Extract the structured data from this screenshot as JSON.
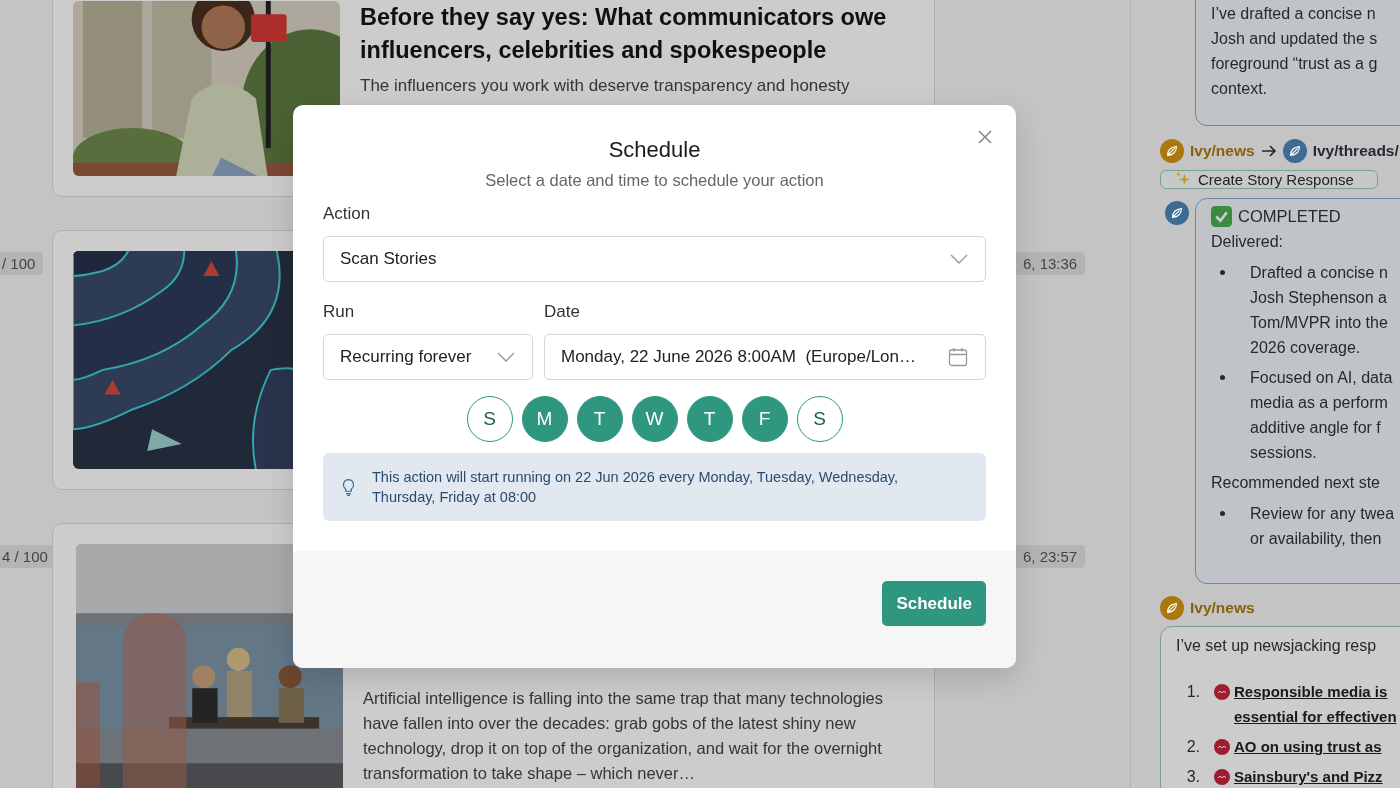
{
  "feed": {
    "cards": [
      {
        "title": "Before they say yes: What communicators owe influencers, celebrities and spokespeople",
        "summary": "The influencers you work with deserve transparency and honesty"
      },
      {
        "score": "/ 100",
        "time": "6, 13:36"
      },
      {
        "score": "4 / 100",
        "time": "6, 23:57",
        "summary": "Artificial intelligence is falling into the same trap that many technologies have fallen into over the decades: grab gobs of the latest shiny new technology, drop it on top of the organization, and wait for the overnight transformation to take shape – which never…"
      }
    ]
  },
  "chat": {
    "items": [
      {
        "kind": "agent_bubble",
        "blocks": [
          {
            "kind": "para",
            "lines": [
              "I’ve drafted a concise n",
              "Josh and updated the s",
              "foreground “trust as a g",
              "context."
            ]
          }
        ]
      },
      {
        "kind": "handoff",
        "from": {
          "name": "Ivy/news",
          "color": "#aa780c"
        },
        "to": {
          "name": "Ivy/threads/",
          "color": "#3e6b93"
        }
      },
      {
        "kind": "action",
        "label": "Create Story Response"
      },
      {
        "kind": "agent_bubble",
        "avatar": {
          "color": "#3e6b93"
        },
        "blocks": [
          {
            "kind": "status",
            "label": "COMPLETED"
          },
          {
            "kind": "para",
            "lines": [
              "Delivered:"
            ]
          },
          {
            "kind": "bullets",
            "items": [
              [
                "Drafted a concise n",
                "Josh Stephenson a",
                "Tom/MVPR into the",
                "2026 coverage."
              ],
              [
                "Focused on AI, data",
                "media as a perform",
                "additive angle for f",
                "sessions."
              ]
            ]
          },
          {
            "kind": "para",
            "lines": [
              "Recommended next ste"
            ]
          },
          {
            "kind": "bullets",
            "items": [
              [
                "Review for any twea",
                "or availability, then"
              ]
            ]
          }
        ]
      },
      {
        "kind": "agent",
        "name": "Ivy/news",
        "color": "#aa780c"
      },
      {
        "kind": "news_bubble",
        "blocks": [
          {
            "kind": "para",
            "lines": [
              "I’ve set up newsjacking resp"
            ]
          },
          {
            "kind": "numbered",
            "items": [
              {
                "number": "1.",
                "lines": [
                  "Responsible media is",
                  "essential for effectiven"
                ]
              },
              {
                "number": "2.",
                "lines": [
                  "AO on using trust as"
                ]
              },
              {
                "number": "3.",
                "lines": [
                  "Sainsbury's and Pizz"
                ]
              }
            ]
          }
        ]
      }
    ]
  },
  "modal": {
    "title": "Schedule",
    "subtitle": "Select a date and time to schedule your action",
    "action": {
      "label": "Action",
      "value": "Scan Stories"
    },
    "run": {
      "label": "Run",
      "value": "Recurring forever"
    },
    "date": {
      "label": "Date",
      "value": "Monday, 22 June 2026 8:00AM  (Europe/Lon…"
    },
    "days": [
      {
        "label": "S",
        "selected": false
      },
      {
        "label": "M",
        "selected": true
      },
      {
        "label": "T",
        "selected": true
      },
      {
        "label": "W",
        "selected": true
      },
      {
        "label": "T",
        "selected": true
      },
      {
        "label": "F",
        "selected": true
      },
      {
        "label": "S",
        "selected": false
      }
    ],
    "info": "This action will start running on 22 Jun 2026 every Monday, Tuesday, Wednesday, Thursday, Friday at 08:00",
    "submit": "Schedule"
  }
}
